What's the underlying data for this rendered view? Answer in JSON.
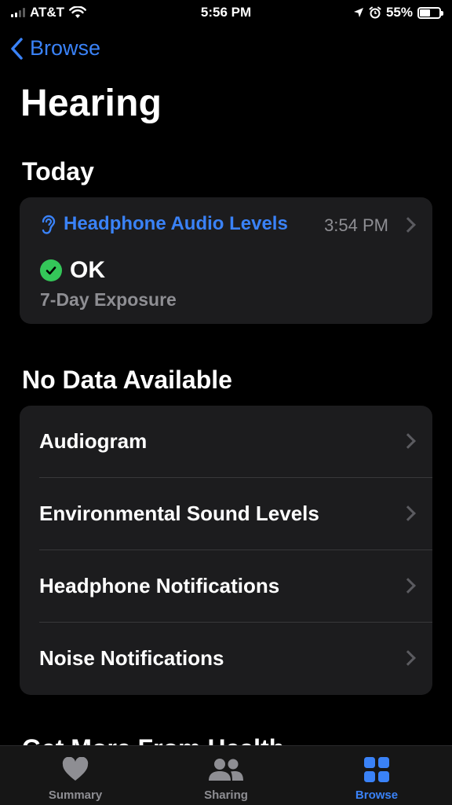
{
  "status_bar": {
    "carrier": "AT&T",
    "time": "5:56 PM",
    "battery": "55%",
    "battery_level": 0.55,
    "icons": [
      "signal-icon",
      "wifi-icon",
      "location-icon",
      "alarm-icon",
      "battery-icon"
    ]
  },
  "nav": {
    "back_label": "Browse"
  },
  "page_title": "Hearing",
  "today": {
    "section_title": "Today",
    "card_title": "Headphone Audio Levels",
    "time": "3:54 PM",
    "status": "OK",
    "subtitle": "7-Day Exposure",
    "status_color": "#34c759",
    "accent_color": "#3a82f7"
  },
  "no_data": {
    "section_title": "No Data Available",
    "items": [
      {
        "label": "Audiogram"
      },
      {
        "label": "Environmental Sound Levels"
      },
      {
        "label": "Headphone Notifications"
      },
      {
        "label": "Noise Notifications"
      }
    ]
  },
  "partial_section_title": "Get More From Health",
  "tab_bar": {
    "tabs": [
      {
        "label": "Summary",
        "icon": "heart-icon",
        "active": false
      },
      {
        "label": "Sharing",
        "icon": "people-icon",
        "active": false
      },
      {
        "label": "Browse",
        "icon": "grid-icon",
        "active": true
      }
    ]
  }
}
